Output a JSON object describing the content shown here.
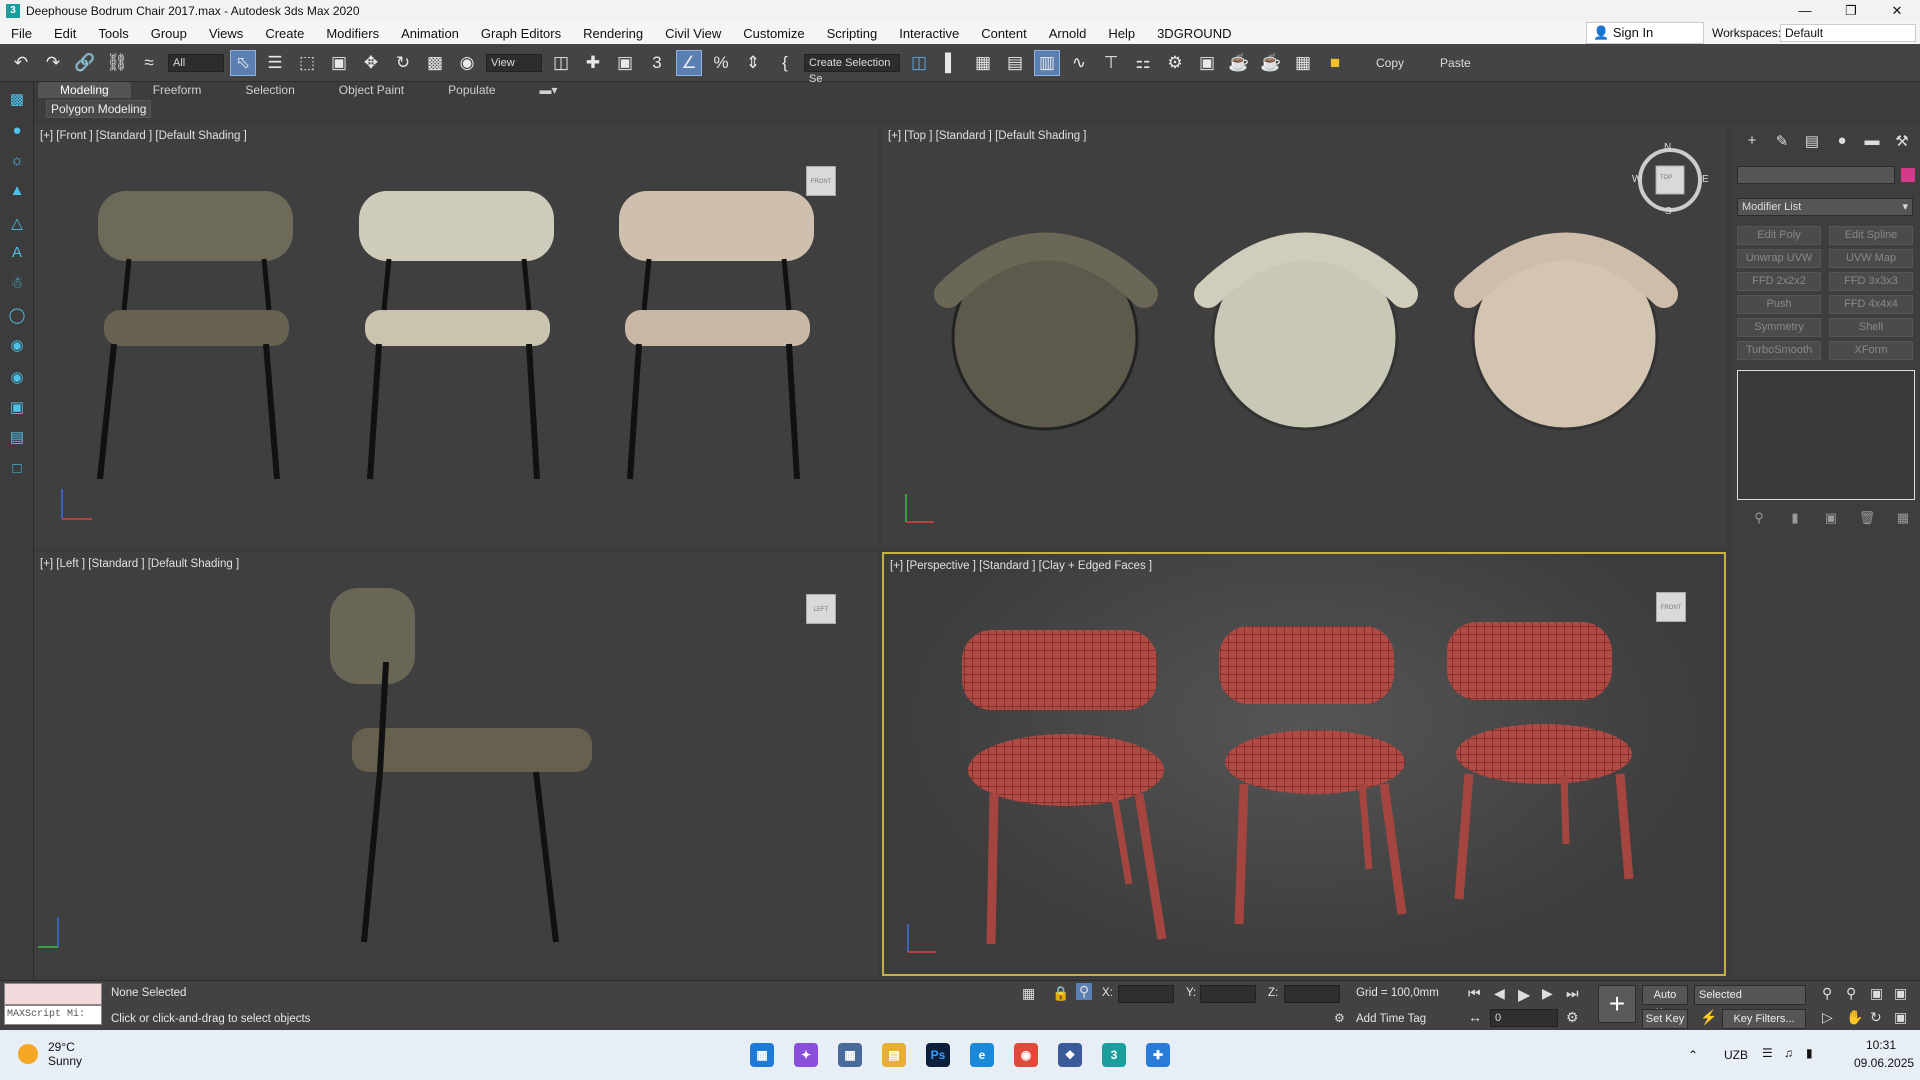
{
  "window": {
    "title": "Deephouse Bodrum Chair 2017.max - Autodesk 3ds Max 2020",
    "app_icon": "3"
  },
  "menu": [
    "File",
    "Edit",
    "Tools",
    "Group",
    "Views",
    "Create",
    "Modifiers",
    "Animation",
    "Graph Editors",
    "Rendering",
    "Civil View",
    "Customize",
    "Scripting",
    "Interactive",
    "Content",
    "Arnold",
    "Help",
    "3DGROUND"
  ],
  "account": {
    "sign_in": "Sign In",
    "workspaces_label": "Workspaces:",
    "workspace": "Default"
  },
  "toolbar": {
    "filter": "All",
    "refcoord": "View",
    "selection_set": "Create Selection Se",
    "copy": "Copy",
    "paste": "Paste"
  },
  "ribbon": {
    "tabs": [
      "Modeling",
      "Freeform",
      "Selection",
      "Object Paint",
      "Populate"
    ],
    "sub": "Polygon Modeling"
  },
  "viewports": {
    "front": {
      "label": "[+] [Front ] [Standard ] [Default Shading ]",
      "cube": "FRONT"
    },
    "top": {
      "label": "[+] [Top ] [Standard ] [Default Shading ]",
      "cube": "TOP",
      "compass": [
        "N",
        "W",
        "E",
        "S"
      ]
    },
    "left": {
      "label": "[+] [Left ] [Standard ] [Default Shading ]",
      "cube": "LEFT"
    },
    "persp": {
      "label": "[+] [Perspective ] [Standard ] [Clay + Edged Faces ]",
      "cube": "FRONT"
    }
  },
  "command_panel": {
    "modifier_list": "Modifier List",
    "buttons": [
      "Edit Poly",
      "Edit Spline",
      "Unwrap UVW",
      "UVW Map",
      "FFD 2x2x2",
      "FFD 3x3x3",
      "Push",
      "FFD 4x4x4",
      "Symmetry",
      "Shell",
      "TurboSmooth",
      "XForm"
    ],
    "color": "#d43a8a"
  },
  "status": {
    "maxscript": "MAXScript Mi:",
    "selection": "None Selected",
    "prompt": "Click or click-and-drag to select objects",
    "x_label": "X:",
    "y_label": "Y:",
    "z_label": "Z:",
    "grid": "Grid = 100,0mm",
    "add_time_tag": "Add Time Tag",
    "auto_key": "Auto Key",
    "set_key": "Set Key",
    "selected": "Selected",
    "key_filters": "Key Filters...",
    "frame": "0"
  },
  "taskbar": {
    "temp": "29°C",
    "weather": "Sunny",
    "lang": "UZB",
    "time": "10:31",
    "date": "09.06.2025"
  }
}
